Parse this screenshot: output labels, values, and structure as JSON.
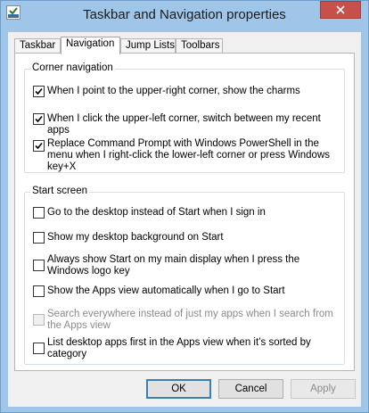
{
  "window": {
    "title": "Taskbar and Navigation properties",
    "close_symbol": "✕"
  },
  "icons": {
    "app": "taskbar-properties-icon",
    "close": "close-icon",
    "check": "checkmark-icon"
  },
  "colors": {
    "frame": "#9fc6e8",
    "close_button": "#c7504b",
    "panel": "#f0f0f0",
    "content": "#ffffff",
    "default_button_border": "#3c7fb1",
    "disabled_text": "#8a8a8a"
  },
  "tabs": [
    {
      "label": "Taskbar",
      "active": false
    },
    {
      "label": "Navigation",
      "active": true
    },
    {
      "label": "Jump Lists",
      "active": false
    },
    {
      "label": "Toolbars",
      "active": false
    }
  ],
  "corner_navigation": {
    "label": "Corner navigation",
    "options": [
      {
        "text": "When I point to the upper-right corner, show the charms",
        "checked": true,
        "enabled": true
      },
      {
        "text": "When I click the upper-left corner, switch between my recent apps",
        "checked": true,
        "enabled": true
      },
      {
        "text": "Replace Command Prompt with Windows PowerShell in the menu when I right-click the lower-left corner or press Windows key+X",
        "checked": true,
        "enabled": true
      }
    ]
  },
  "start_screen": {
    "label": "Start screen",
    "options": [
      {
        "text": "Go to the desktop instead of Start when I sign in",
        "checked": false,
        "enabled": true
      },
      {
        "text": "Show my desktop background on Start",
        "checked": false,
        "enabled": true
      },
      {
        "text": "Always show Start on my main display when I press the Windows logo key",
        "checked": false,
        "enabled": true
      },
      {
        "text": "Show the Apps view automatically when I go to Start",
        "checked": false,
        "enabled": true
      },
      {
        "text": "Search everywhere instead of just my apps when I search from the Apps view",
        "checked": false,
        "enabled": false
      },
      {
        "text": "List desktop apps first in the Apps view when it’s sorted by category",
        "checked": false,
        "enabled": true
      }
    ]
  },
  "buttons": {
    "ok": "OK",
    "cancel": "Cancel",
    "apply": "Apply"
  }
}
